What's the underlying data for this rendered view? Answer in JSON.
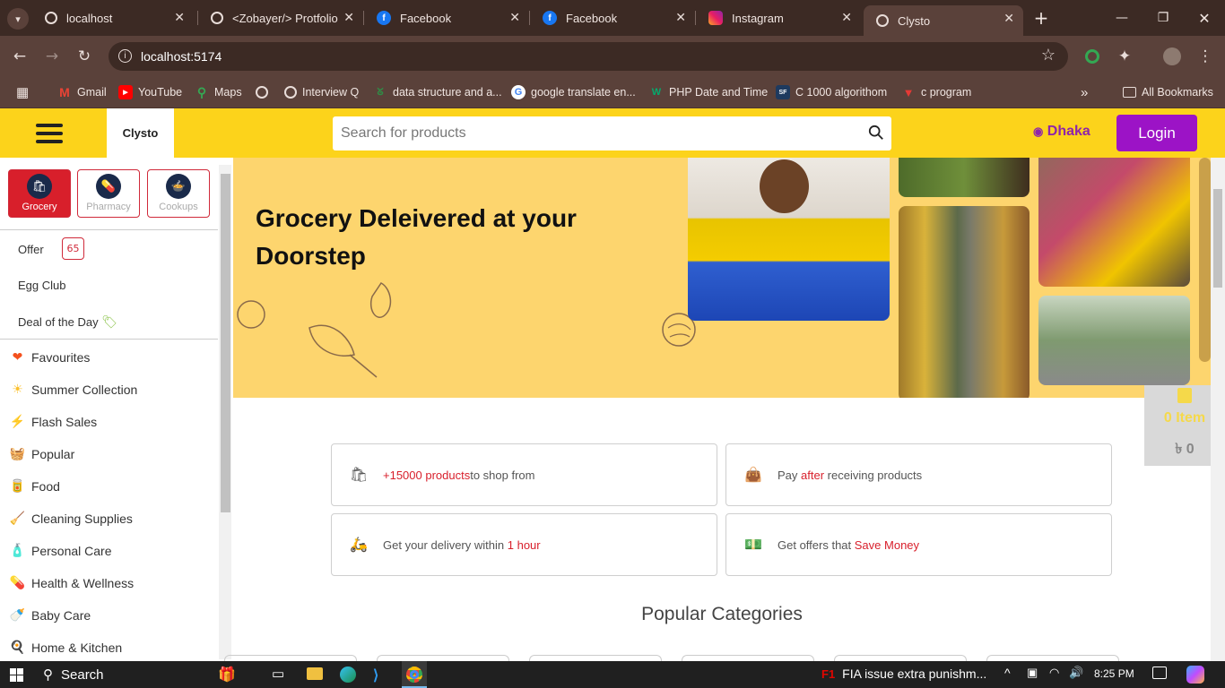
{
  "browser": {
    "tabs": [
      {
        "title": "localhost",
        "icon": "globe-icon"
      },
      {
        "title": "<Zobayer/> Protfolio",
        "icon": "globe-icon"
      },
      {
        "title": "Facebook",
        "icon": "facebook-icon"
      },
      {
        "title": "Facebook",
        "icon": "facebook-icon"
      },
      {
        "title": "Instagram",
        "icon": "instagram-icon"
      },
      {
        "title": "Clysto",
        "icon": "globe-icon"
      }
    ],
    "url": "localhost:5174",
    "bookmarks": [
      {
        "label": "Gmail"
      },
      {
        "label": "YouTube"
      },
      {
        "label": "Maps"
      },
      {
        "label": ""
      },
      {
        "label": "Interview Q"
      },
      {
        "label": "data structure and a..."
      },
      {
        "label": "google translate en..."
      },
      {
        "label": "PHP Date and Time"
      },
      {
        "label": "C 1000  algorithom"
      },
      {
        "label": "c program"
      }
    ],
    "all_bookmarks": "All Bookmarks"
  },
  "header": {
    "logo": "Clysto",
    "search_placeholder": "Search for products",
    "location": "Dhaka",
    "login": "Login"
  },
  "sidebar": {
    "top_categories": [
      {
        "label": "Grocery",
        "active": true
      },
      {
        "label": "Pharmacy",
        "active": false
      },
      {
        "label": "Cookups",
        "active": false
      }
    ],
    "offer": "Offer",
    "offer_count": "65",
    "egg_club": "Egg Club",
    "deal": "Deal of the Day",
    "items": [
      {
        "label": "Favourites",
        "icon": "heart-icon"
      },
      {
        "label": "Summer Collection",
        "icon": "sun-icon"
      },
      {
        "label": "Flash Sales",
        "icon": "lightning-icon"
      },
      {
        "label": "Popular",
        "icon": "basket-icon"
      },
      {
        "label": "Food",
        "icon": "food-icon"
      },
      {
        "label": "Cleaning Supplies",
        "icon": "cleaning-icon"
      },
      {
        "label": "Personal Care",
        "icon": "personal-care-icon"
      },
      {
        "label": "Health & Wellness",
        "icon": "health-icon"
      },
      {
        "label": "Baby Care",
        "icon": "baby-icon"
      },
      {
        "label": "Home & Kitchen",
        "icon": "kitchen-icon"
      }
    ]
  },
  "hero": {
    "headline": "Grocery Deleivered at your Doorstep"
  },
  "features": [
    {
      "pre": "",
      "hl": "+15000 products",
      "post": " to shop from"
    },
    {
      "pre": "Pay ",
      "hl": "after",
      "post": " receiving products"
    },
    {
      "pre": "Get your delivery within ",
      "hl": "1 hour",
      "post": ""
    },
    {
      "pre": "Get offers that ",
      "hl": "Save Money",
      "post": ""
    }
  ],
  "popular_categories": "Popular Categories",
  "cart": {
    "items": "0 Item",
    "total": "৳ 0"
  },
  "taskbar": {
    "search": "Search",
    "news": "FIA issue extra punishm...",
    "time": "8:25 PM"
  }
}
